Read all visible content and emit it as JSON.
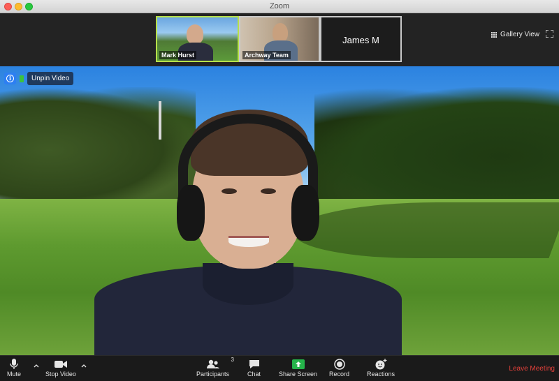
{
  "window": {
    "title": "Zoom"
  },
  "thumbnails": [
    {
      "name": "Mark Hurst",
      "active": true
    },
    {
      "name": "Archway Team",
      "active": false
    },
    {
      "name": "James M",
      "active": false
    }
  ],
  "top_controls": {
    "gallery_label": "Gallery View",
    "gallery_icon": "grid-icon",
    "fullscreen_icon": "fullscreen-icon"
  },
  "video_controls": {
    "unpin_label": "Unpin Video"
  },
  "toolbar": {
    "mute_label": "Mute",
    "stop_video_label": "Stop Video",
    "participants_label": "Participants",
    "participants_count": "3",
    "chat_label": "Chat",
    "share_label": "Share Screen",
    "record_label": "Record",
    "reactions_label": "Reactions",
    "leave_label": "Leave Meeting"
  },
  "colors": {
    "accent": "#2d7ff2",
    "active_border": "#b7e04a",
    "share_green": "#25b34a",
    "leave_red": "#e5413b"
  }
}
